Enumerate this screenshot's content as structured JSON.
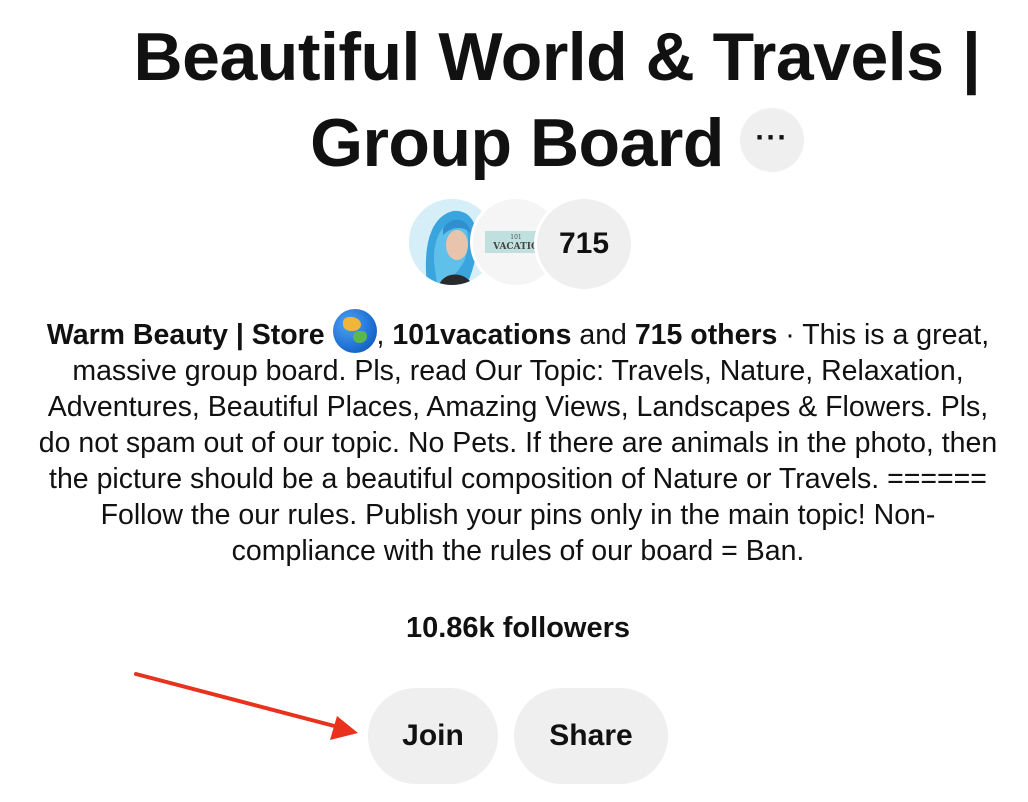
{
  "board": {
    "title_line1": "Beautiful World & Travels |",
    "title_line2": "Group Board",
    "more_label": "···"
  },
  "collaborators": {
    "count_label": "715",
    "avatar1_alt": "Warm Beauty | Store avatar",
    "avatar2_text_top": "101",
    "avatar2_text_main": "VACATIO"
  },
  "description": {
    "name1": "Warm Beauty | Store ",
    "sep1": ", ",
    "name2": "101vacations",
    "and": " and ",
    "others": "715 others",
    "dot": " · ",
    "text": "This is a great, massive group board. Pls, read Our Topic: Travels, Nature, Relaxation, Adventures, Beautiful Places, Amazing Views, Landscapes & Flowers. Pls, do not spam out of our topic. No Pets. If there are animals in the photo, then the picture should be a beautiful composition of Nature or Travels. ====== Follow the our rules. Publish your pins only in the main topic! Non-compliance with the rules of our board = Ban."
  },
  "stats": {
    "followers": "10.86k followers"
  },
  "actions": {
    "join_label": "Join",
    "share_label": "Share"
  },
  "colors": {
    "pill_bg": "#efefef",
    "arrow": "#e8321e",
    "text": "#111111"
  },
  "icons": [
    "more-icon",
    "globe-icon",
    "arrow-annotation"
  ]
}
